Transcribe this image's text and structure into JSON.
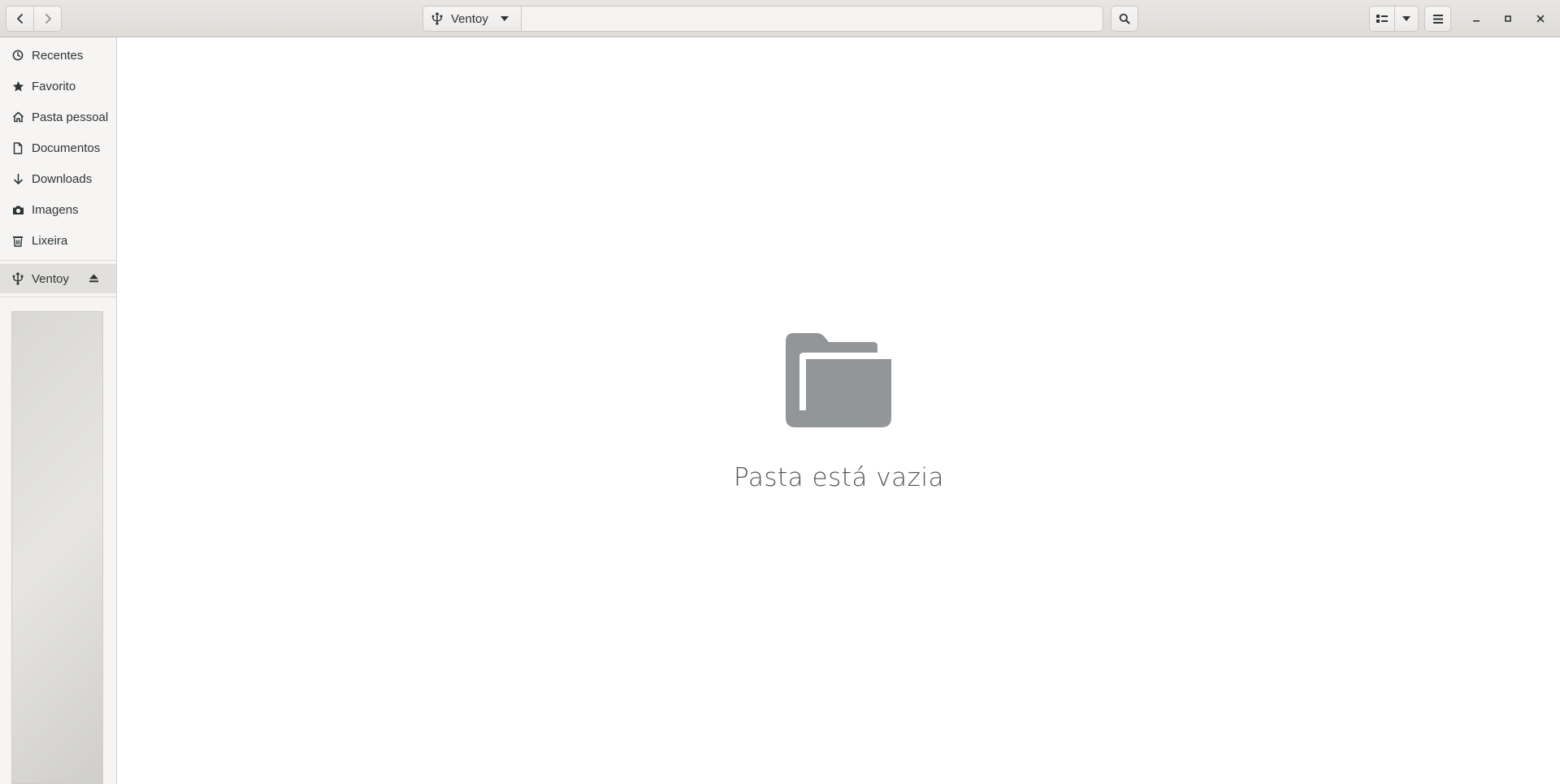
{
  "header": {
    "back_icon": "chevron-left-icon",
    "forward_icon": "chevron-right-icon",
    "path_bar": {
      "icon": "usb-icon",
      "label": "Ventoy",
      "dropdown_icon": "triangle-down-icon"
    },
    "location": {
      "value": ""
    },
    "search_icon": "search-icon",
    "view_icon": "list-view-icon",
    "view_dropdown_icon": "triangle-down-icon",
    "menu_icon": "hamburger-menu-icon",
    "window_controls": [
      "minimize-icon",
      "maximize-icon",
      "close-icon"
    ]
  },
  "sidebar": {
    "places": [
      {
        "label": "Recentes",
        "icon": "clock-icon"
      },
      {
        "label": "Favorito",
        "icon": "star-icon"
      },
      {
        "label": "Pasta pessoal",
        "icon": "home-icon"
      },
      {
        "label": "Documentos",
        "icon": "document-icon"
      },
      {
        "label": "Downloads",
        "icon": "download-icon"
      },
      {
        "label": "Imagens",
        "icon": "camera-icon"
      },
      {
        "label": "Lixeira",
        "icon": "trash-icon"
      }
    ],
    "devices": [
      {
        "label": "Ventoy",
        "icon": "usb-icon",
        "eject_icon": "eject-icon",
        "selected": true
      }
    ]
  },
  "main": {
    "empty_icon": "folder-icon",
    "empty_text": "Pasta está vazia"
  },
  "colors": {
    "headerbar": "#e8e6e3",
    "sidebar": "#f6f5f4",
    "selected": "#e2e0dd",
    "folder_icon": "#939698",
    "text": "#2e3436"
  }
}
